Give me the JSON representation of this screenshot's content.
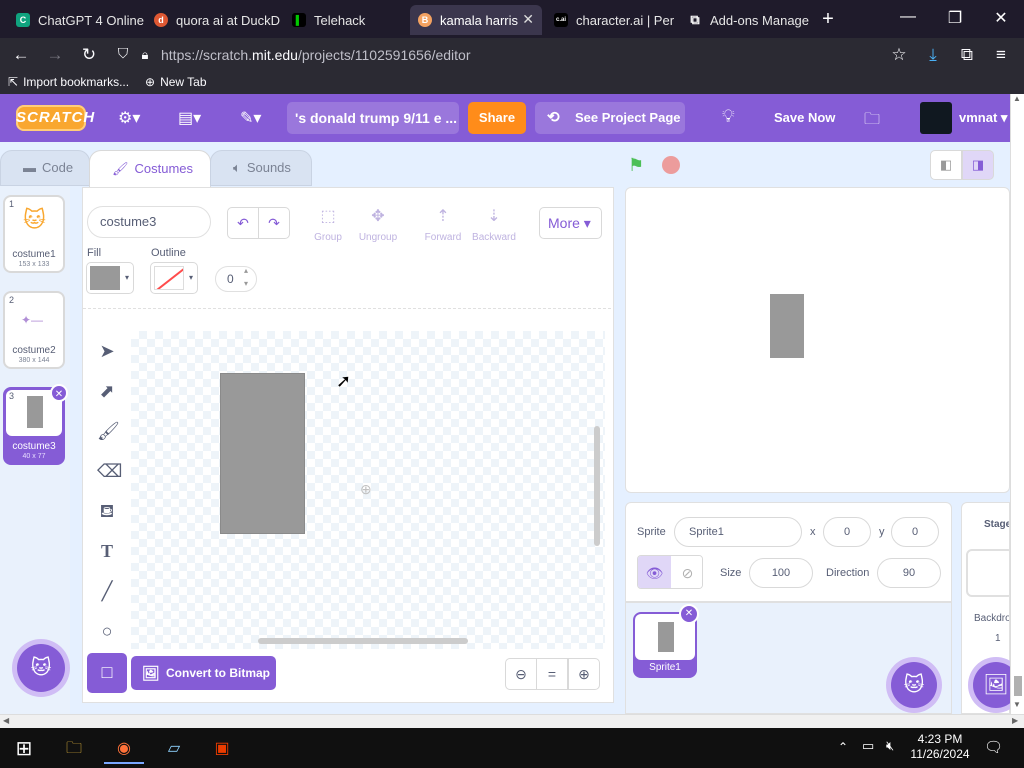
{
  "browser": {
    "tabs": [
      {
        "title": "ChatGPT 4 Online",
        "fav_color": "#10a37f",
        "fav_glyph": "C"
      },
      {
        "title": "quora ai at DuckD",
        "fav_color": "#de5833",
        "fav_glyph": "d"
      },
      {
        "title": "Telehack",
        "fav_color": "#00c800",
        "fav_glyph": "▌"
      },
      {
        "title": "kamala harris",
        "fav_color": "#f4a261",
        "fav_glyph": "B",
        "active": true
      },
      {
        "title": "character.ai | Per",
        "fav_color": "#000000",
        "fav_glyph": "c.ai"
      },
      {
        "title": "Add-ons Manage",
        "fav_color": "#2b2a33",
        "fav_glyph": "⧉"
      }
    ],
    "new_tab_glyph": "+",
    "url_prefix": "https://scratch.",
    "url_domain": "mit.edu",
    "url_path": "/projects/1102591656/editor",
    "bookmarks": [
      {
        "label": "Import bookmarks..."
      },
      {
        "label": "New Tab"
      }
    ]
  },
  "menubar": {
    "logo": "SCRATCH",
    "project_title": "'s donald trump 9/11 e ...",
    "share_label": "Share",
    "see_project_label": "See Project Page",
    "save_now_label": "Save Now",
    "username": "vmnat"
  },
  "editor_tabs": {
    "code": "Code",
    "costumes": "Costumes",
    "sounds": "Sounds"
  },
  "costumes": [
    {
      "num": "1",
      "name": "costume1",
      "size": "153 x 133"
    },
    {
      "num": "2",
      "name": "costume2",
      "size": "380 x 144"
    },
    {
      "num": "3",
      "name": "costume3",
      "size": "40 x 77",
      "selected": true
    }
  ],
  "paint": {
    "costume_name": "costume3",
    "tools_top": [
      {
        "label": "Group"
      },
      {
        "label": "Ungroup"
      },
      {
        "label": "Forward"
      },
      {
        "label": "Backward"
      }
    ],
    "more_label": "More",
    "fill_label": "Fill",
    "outline_label": "Outline",
    "fill_color": "#999999",
    "stroke_width": "0",
    "convert_label": "Convert to Bitmap",
    "zoom_reset": "="
  },
  "sprite": {
    "label": "Sprite",
    "name": "Sprite1",
    "x_label": "x",
    "x": "0",
    "y_label": "y",
    "y": "0",
    "size_label": "Size",
    "size": "100",
    "direction_label": "Direction",
    "direction": "90",
    "list": [
      {
        "name": "Sprite1"
      }
    ]
  },
  "stage_panel": {
    "title": "Stage",
    "backdrops_label": "Backdro",
    "backdrops_count": "1"
  },
  "taskbar": {
    "time": "4:23 PM",
    "date": "11/26/2024"
  },
  "colors": {
    "scratch_purple": "#855cd6",
    "share_orange": "#ff8c1a",
    "costume_gray": "#999999"
  }
}
